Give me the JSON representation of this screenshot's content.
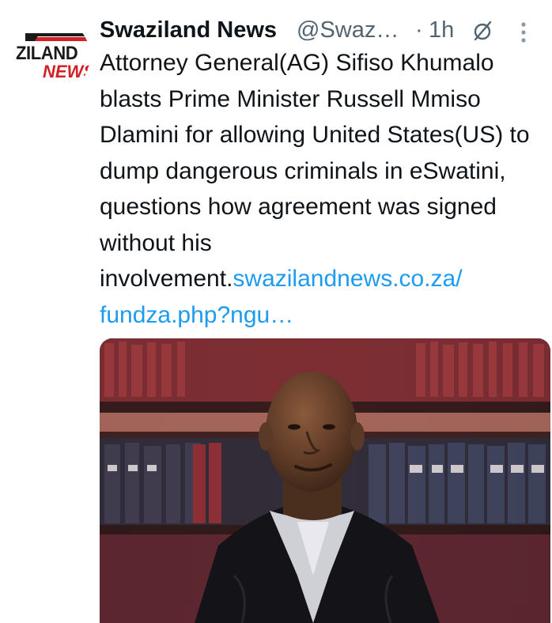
{
  "avatar": {
    "logo_line1": "ZILAND",
    "logo_line2": "NEWS",
    "colors": {
      "black": "#1a1a1a",
      "red": "#d32027"
    }
  },
  "header": {
    "display_name": "Swaziland News",
    "handle": "@Swaz…",
    "separator": "·",
    "timestamp": "1h",
    "icons": [
      "no-edit-icon",
      "more-options-icon"
    ]
  },
  "tweet": {
    "text": "Attorney General(AG) Sifiso Khumalo blasts Prime Minister Russell Mmiso Dlamini for allowing United States(US) to dump dangerous criminals in eSwatini, questions how agreement was signed without his involvement.",
    "link_text": "swazilandnews.co.za/ fundza.php?ngu…"
  },
  "media": {
    "type": "photo"
  },
  "colors": {
    "text": "#0f1419",
    "secondary": "#536471",
    "link": "#1d9bf0",
    "background": "#ffffff"
  }
}
